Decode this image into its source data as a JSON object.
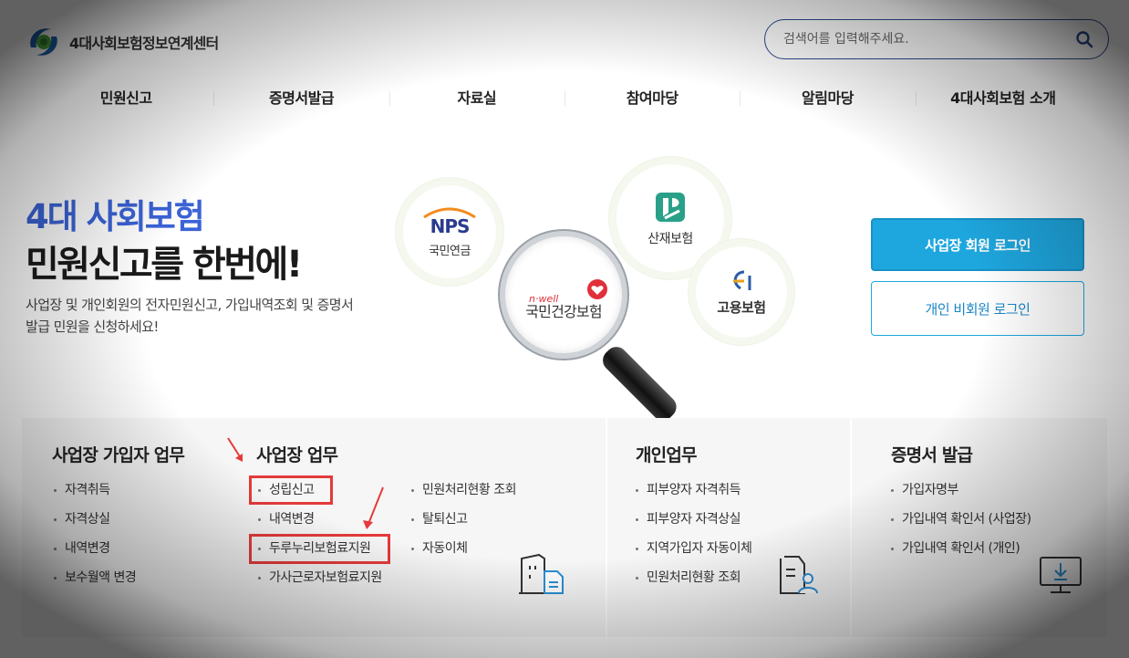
{
  "header": {
    "logo_text": "4대사회보험정보연계센터",
    "search_placeholder": "검색어를 입력해주세요."
  },
  "nav": {
    "items": [
      "민원신고",
      "증명서발급",
      "자료실",
      "참여마당",
      "알림마당",
      "4대사회보험 소개"
    ]
  },
  "hero": {
    "title_line1": "4대 사회보험",
    "title_line2": "민원신고를 한번에!",
    "description": "사업장 및 개인회원의 전자민원신고, 가입내역조회 및 증명서 발급 민원을 신청하세요!"
  },
  "agencies": {
    "nps_logo": "NPS",
    "nps_label": "국민연금",
    "kcomwel_label": "산재보험",
    "nhis_small": "n·well",
    "nhis_label": "국민건강보험",
    "ei_label": "고용보험"
  },
  "login": {
    "business": "사업장 회원 로그인",
    "individual": "개인 비회원 로그인"
  },
  "sections": {
    "subscriber": {
      "title": "사업장 가입자 업무",
      "items": [
        "자격취득",
        "자격상실",
        "내역변경",
        "보수월액 변경"
      ]
    },
    "business": {
      "title": "사업장 업무",
      "col1": [
        "성립신고",
        "내역변경",
        "두루누리보험료지원",
        "가사근로자보험료지원"
      ],
      "col2": [
        "민원처리현황 조회",
        "탈퇴신고",
        "자동이체"
      ]
    },
    "personal": {
      "title": "개인업무",
      "items": [
        "피부양자 자격취득",
        "피부양자 자격상실",
        "지역가입자 자동이체",
        "민원처리현황 조회"
      ]
    },
    "certificate": {
      "title": "증명서 발급",
      "items": [
        "가입자명부",
        "가입내역 확인서 (사업장)",
        "가입내역 확인서 (개인)"
      ]
    }
  },
  "colors": {
    "accent_blue": "#3b63d6",
    "button_blue": "#1ea7df",
    "highlight_red": "#e53a3a"
  }
}
